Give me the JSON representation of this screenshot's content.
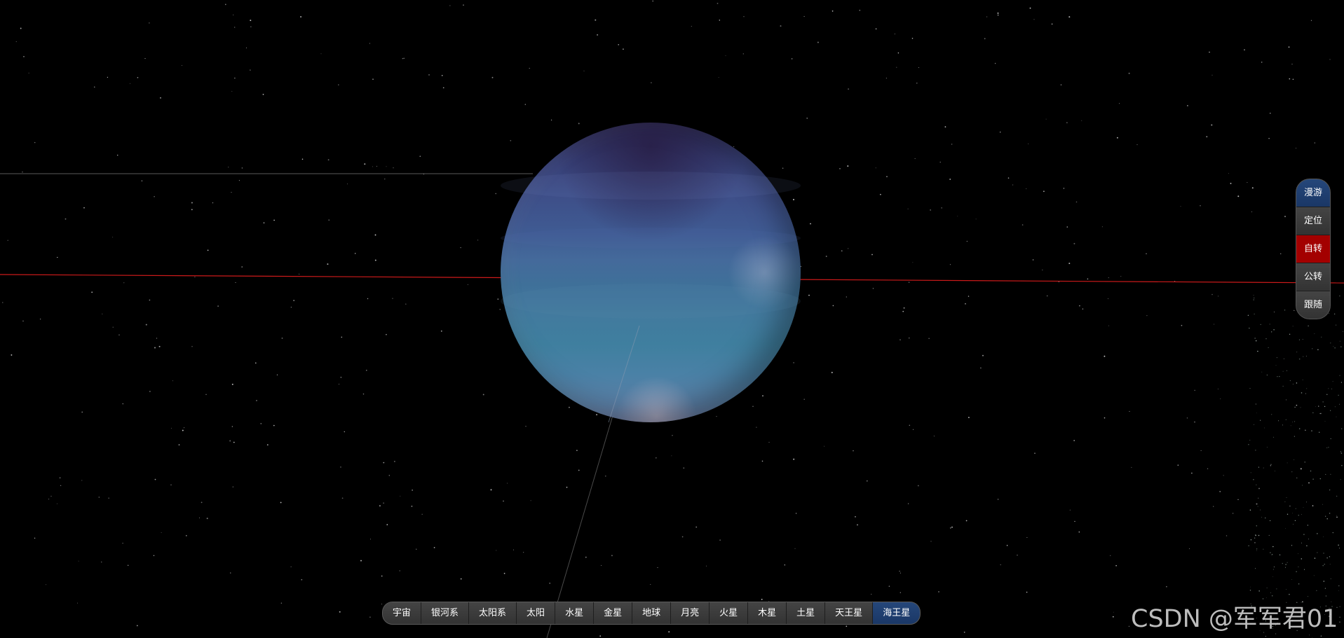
{
  "nav": {
    "items": [
      {
        "label": "宇宙"
      },
      {
        "label": "银河系"
      },
      {
        "label": "太阳系"
      },
      {
        "label": "太阳"
      },
      {
        "label": "水星"
      },
      {
        "label": "金星"
      },
      {
        "label": "地球"
      },
      {
        "label": "月亮"
      },
      {
        "label": "火星"
      },
      {
        "label": "木星"
      },
      {
        "label": "土星"
      },
      {
        "label": "天王星"
      },
      {
        "label": "海王星"
      }
    ],
    "active": "海王星"
  },
  "controls": {
    "items": [
      {
        "label": "漫游"
      },
      {
        "label": "定位"
      },
      {
        "label": "自转"
      },
      {
        "label": "公转"
      },
      {
        "label": "跟随"
      }
    ]
  },
  "watermark": {
    "text": "CSDN @军军君01"
  },
  "colors": {
    "active_blue": "#1f3f72",
    "rotation_active_red": "#a30000",
    "orbit_line_red": "#cc1a1a",
    "background": "#000000"
  }
}
